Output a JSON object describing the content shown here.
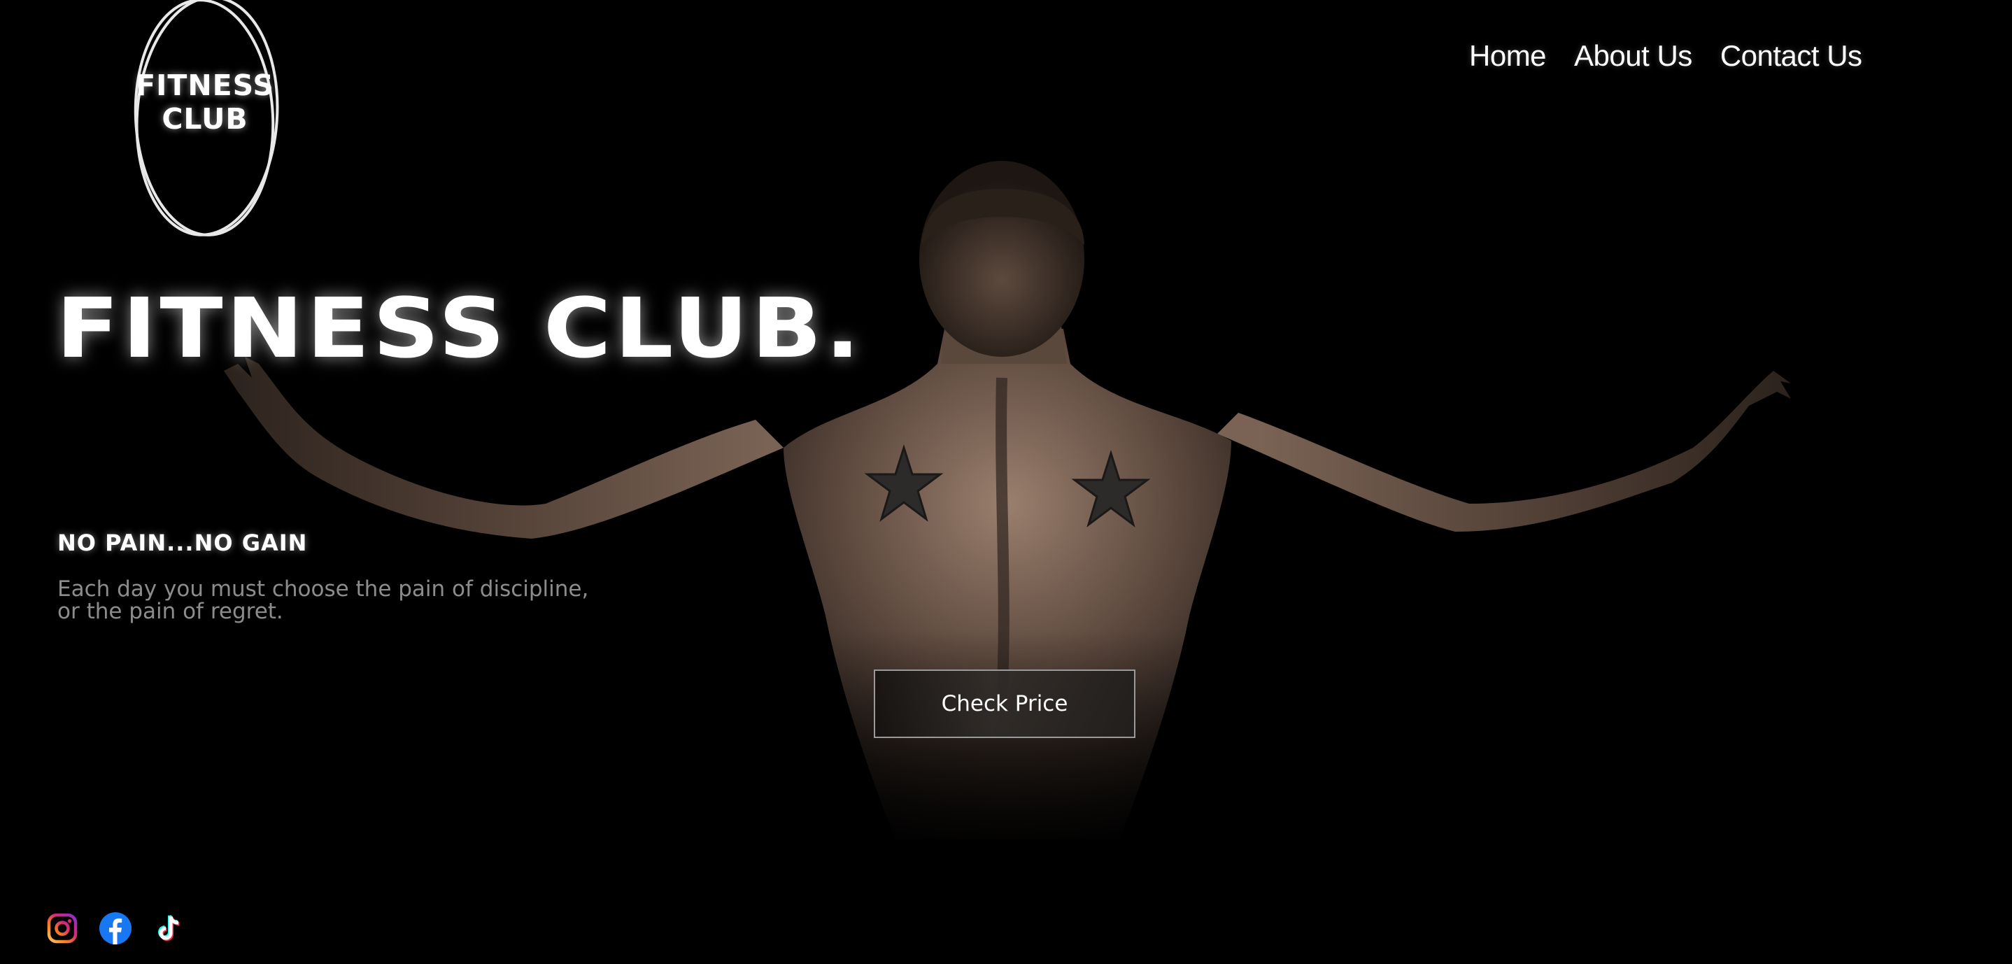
{
  "logo": {
    "line1": "FITNESS",
    "line2": "CLUB",
    "icon": "oval-ring-icon"
  },
  "nav": {
    "items": [
      {
        "label": "Home"
      },
      {
        "label": "About Us"
      },
      {
        "label": "Contact Us"
      }
    ]
  },
  "hero": {
    "headline": "FITNESS CLUB.",
    "tagline": "NO PAIN...NO GAIN",
    "quote_line1": "Each day you must choose the pain of discipline,",
    "quote_line2": "or the pain of regret.",
    "cta_label": "Check Price",
    "image": "muscular-back-arms-outstretched"
  },
  "social": {
    "items": [
      {
        "icon": "instagram-icon"
      },
      {
        "icon": "facebook-icon"
      },
      {
        "icon": "tiktok-icon"
      }
    ]
  },
  "colors": {
    "background": "#000000",
    "text": "#ffffff",
    "muted_text": "#8c8c8c",
    "button_border": "#9a9a9a",
    "facebook_blue": "#1877f2",
    "instagram_pink": "#e1306c"
  }
}
